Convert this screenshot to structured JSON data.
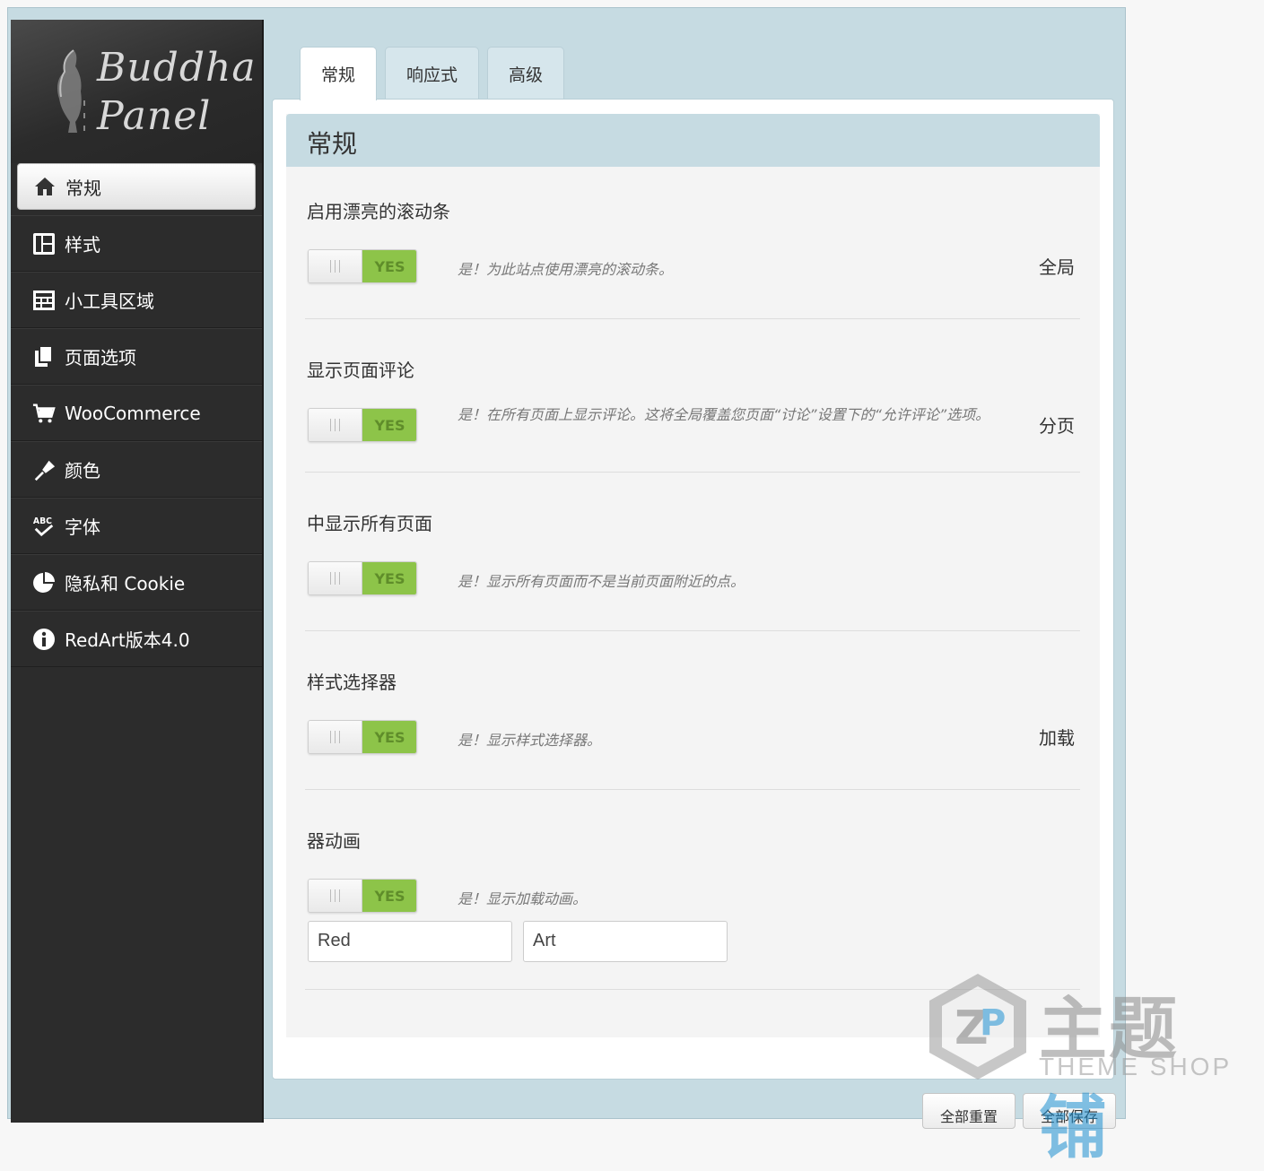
{
  "logo": {
    "line1": "Buddha",
    "line2": "Panel"
  },
  "sidebar": {
    "items": [
      {
        "label": "常规",
        "icon": "home-icon"
      },
      {
        "label": "样式",
        "icon": "layout-icon"
      },
      {
        "label": "小工具区域",
        "icon": "widgets-icon"
      },
      {
        "label": "页面选项",
        "icon": "pages-icon"
      },
      {
        "label": "WooCommerce",
        "icon": "cart-icon"
      },
      {
        "label": "颜色",
        "icon": "brush-icon"
      },
      {
        "label": "字体",
        "icon": "spellcheck-icon"
      },
      {
        "label": "隐私和 Cookie",
        "icon": "pie-chart-icon"
      },
      {
        "label": "RedArt版本4.0",
        "icon": "info-icon"
      }
    ],
    "active_index": 0
  },
  "tabs": [
    {
      "label": "常规",
      "active": true
    },
    {
      "label": "响应式",
      "active": false
    },
    {
      "label": "高级",
      "active": false
    }
  ],
  "section": {
    "title": "常规"
  },
  "options": [
    {
      "title": "启用漂亮的滚动条",
      "toggle": "YES",
      "desc": "是！为此站点使用漂亮的滚动条。",
      "right": "全局"
    },
    {
      "title": "显示页面评论",
      "toggle": "YES",
      "desc": "是！在所有页面上显示评论。这将全局覆盖您页面“讨论”设置下的“允许评论”选项。",
      "right": "分页"
    },
    {
      "title": "中显示所有页面",
      "toggle": "YES",
      "desc": "是！显示所有页面而不是当前页面附近的点。",
      "right": ""
    },
    {
      "title": "样式选择器",
      "toggle": "YES",
      "desc": "是！显示样式选择器。",
      "right": "加载"
    },
    {
      "title": "器动画",
      "toggle": "YES",
      "desc": "是！显示加载动画。",
      "right": ""
    }
  ],
  "fields": [
    {
      "value": "Red"
    },
    {
      "value": "Art"
    }
  ],
  "footer": {
    "reset_label": "全部重置",
    "save_label": "全部保存"
  },
  "watermark": {
    "cn": "主题",
    "cn_hl": "铺",
    "en": "THEME SHOP"
  },
  "colors": {
    "sidebar_bg": "#2c2c2c",
    "frame_bg": "#c6dbe2",
    "toggle_on": "#8dc449"
  }
}
